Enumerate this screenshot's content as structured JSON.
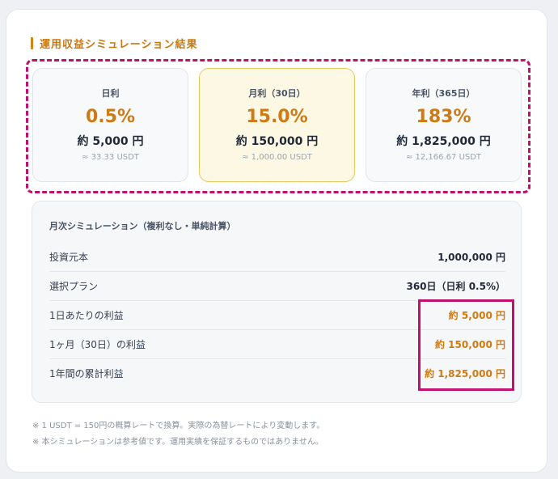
{
  "section": {
    "title": "運用収益シミュレーション結果"
  },
  "cards": [
    {
      "label": "日利",
      "rate": "0.5%",
      "yen": "約 5,000 円",
      "usdt": "≈ 33.33 USDT"
    },
    {
      "label": "月利（30日）",
      "rate": "15.0%",
      "yen": "約 150,000 円",
      "usdt": "≈ 1,000.00 USDT"
    },
    {
      "label": "年利（365日）",
      "rate": "183%",
      "yen": "約 1,825,000 円",
      "usdt": "≈ 12,166.67 USDT"
    }
  ],
  "monthly": {
    "title": "月次シミュレーション（複利なし・単純計算）",
    "rows": [
      {
        "k": "投資元本",
        "v": "1,000,000 円"
      },
      {
        "k": "選択プラン",
        "v": "360日（日利 0.5%）"
      },
      {
        "k": "1日あたりの利益",
        "v": "約 5,000 円"
      },
      {
        "k": "1ヶ月（30日）の利益",
        "v": "約 150,000 円"
      },
      {
        "k": "1年間の累計利益",
        "v": "約 1,825,000 円"
      }
    ]
  },
  "notes": [
    "※ 1 USDT = 150円の概算レートで換算。実際の為替レートにより変動します。",
    "※ 本シミュレーションは参考値です。運用実績を保証するものではありません。"
  ],
  "colors": {
    "accent": "#cf7a12",
    "highlight": "#c2106f",
    "active_card_bg": "#fdf8e4"
  }
}
